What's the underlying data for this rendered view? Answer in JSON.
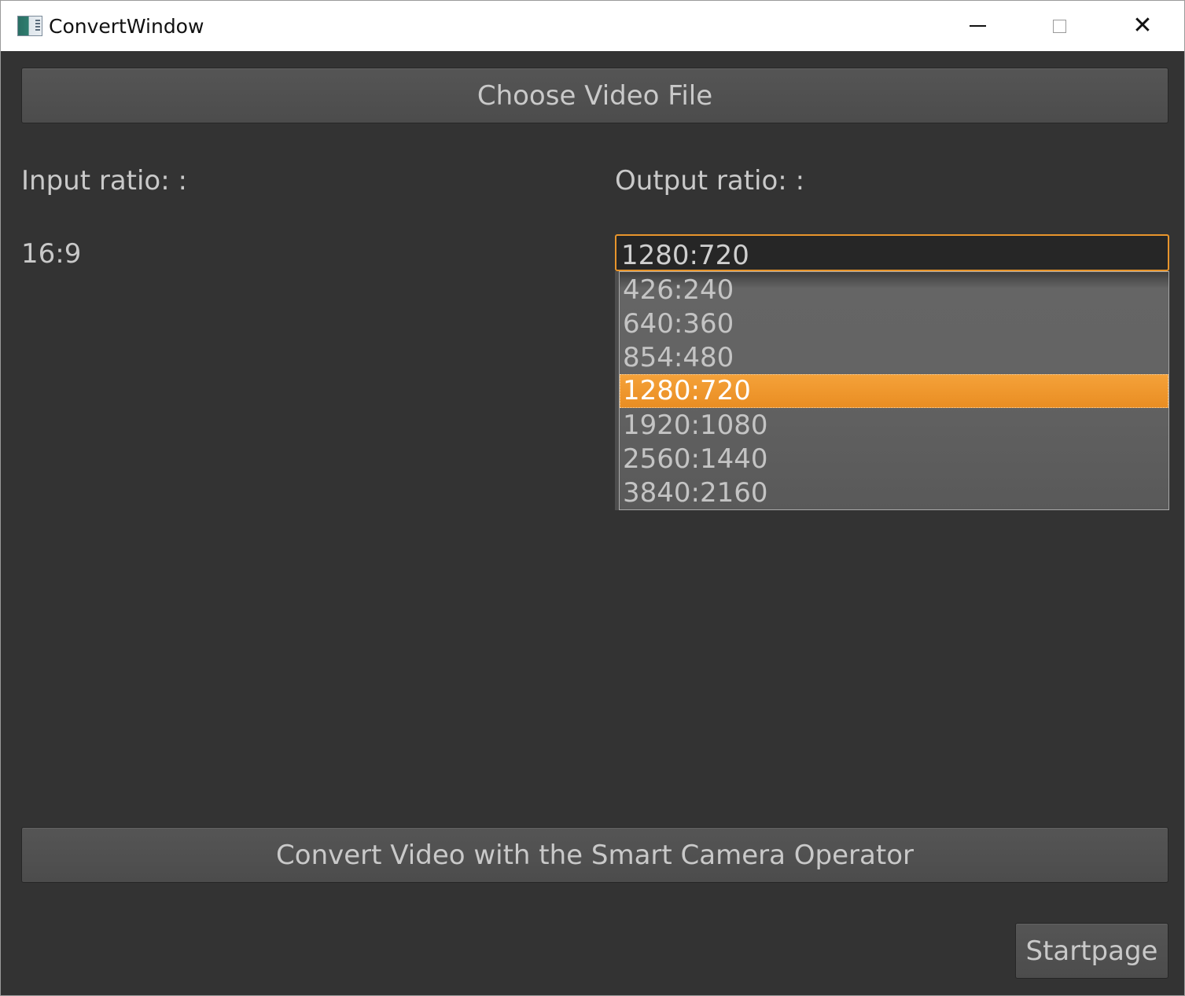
{
  "window": {
    "title": "ConvertWindow"
  },
  "icons": {
    "app": "app-icon",
    "minimize": "minimize-icon",
    "maximize": "maximize-icon",
    "close": "close-icon"
  },
  "titlebar_glyphs": {
    "close": "✕"
  },
  "buttons": {
    "choose_label": "Choose Video File",
    "convert_label": "Convert Video with the Smart Camera Operator",
    "startpage_label": "Startpage"
  },
  "input": {
    "label": "Input ratio: :",
    "value": "16:9"
  },
  "output": {
    "label": "Output ratio: :",
    "selected": "1280:720",
    "options": [
      "426:240",
      "640:360",
      "854:480",
      "1280:720",
      "1920:1080",
      "2560:1440",
      "3840:2160"
    ],
    "highlighted_index": 3
  },
  "colors": {
    "background": "#333333",
    "accent": "#f39c2f",
    "text": "#c9c9c9"
  }
}
